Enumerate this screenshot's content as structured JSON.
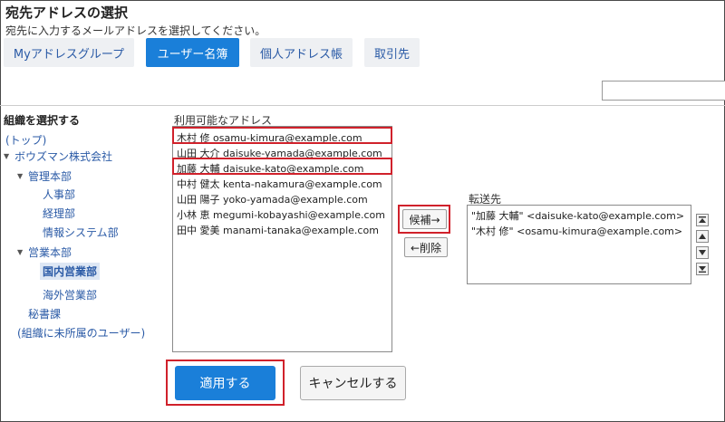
{
  "header": {
    "title": "宛先アドレスの選択",
    "subtitle": "宛先に入力するメールアドレスを選択してください。"
  },
  "tabs": [
    {
      "label": "Myアドレスグループ",
      "active": false
    },
    {
      "label": "ユーザー名簿",
      "active": true
    },
    {
      "label": "個人アドレス帳",
      "active": false
    },
    {
      "label": "取引先",
      "active": false
    }
  ],
  "search": {
    "value": "",
    "placeholder": ""
  },
  "tree": {
    "heading": "組織を選択する",
    "items": [
      {
        "label": "(トップ)"
      },
      {
        "label": "ボウズマン株式会社"
      },
      {
        "label": "管理本部"
      },
      {
        "label": "人事部"
      },
      {
        "label": "経理部"
      },
      {
        "label": "情報システム部"
      },
      {
        "label": "営業本部"
      },
      {
        "label": "国内営業部"
      },
      {
        "label": "海外営業部"
      },
      {
        "label": "秘書課"
      },
      {
        "label": "(組織に未所属のユーザー)"
      }
    ]
  },
  "available": {
    "label": "利用可能なアドレス",
    "options": [
      "木村 修 osamu-kimura@example.com",
      "山田 大介 daisuke-yamada@example.com",
      "加藤 大輔 daisuke-kato@example.com",
      "中村 健太 kenta-nakamura@example.com",
      "山田 陽子 yoko-yamada@example.com",
      "小林 恵 megumi-kobayashi@example.com",
      "田中 愛美 manami-tanaka@example.com"
    ]
  },
  "actions": {
    "add": "候補→",
    "remove": "←削除"
  },
  "forward": {
    "label": "転送先",
    "options": [
      "\"加藤 大輔\" <daisuke-kato@example.com>",
      "\"木村 修\" <osamu-kimura@example.com>"
    ]
  },
  "footer": {
    "apply": "適用する",
    "cancel": "キャンセルする"
  },
  "colors": {
    "accent": "#1a7fd9",
    "highlight": "#d0212b"
  }
}
